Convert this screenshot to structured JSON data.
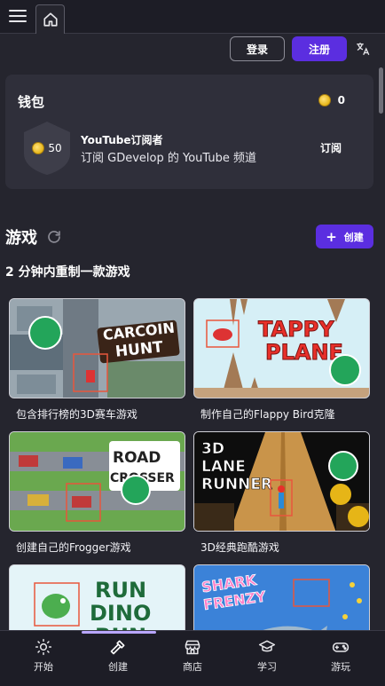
{
  "topbar": {
    "menu_icon": "hamburger-menu-icon",
    "home_icon": "home-icon"
  },
  "auth": {
    "login": "登录",
    "signup": "注册",
    "language_icon": "translate-icon"
  },
  "wallet": {
    "title": "钱包",
    "coins": "0",
    "badge_coins": "50",
    "youtube_title": "YouTube订阅者",
    "youtube_desc": "订阅 GDevelop 的 YouTube 频道",
    "subscribe": "订阅"
  },
  "games": {
    "title": "游戏",
    "create": "创建",
    "subtitle": "2 分钟内重制一款游戏",
    "cards": [
      {
        "label": "包含排行榜的3D赛车游戏",
        "art": "CARCOIN HUNT"
      },
      {
        "label": "制作自己的Flappy Bird克隆",
        "art": "TAPPY PLANE"
      },
      {
        "label": "创建自己的Frogger游戏",
        "art": "ROAD CROSSER"
      },
      {
        "label": "3D经典跑酷游戏",
        "art": "3D LANE RUNNER"
      },
      {
        "label": "",
        "art": "RUN DINO RUN"
      },
      {
        "label": "",
        "art": "SHARK FRENZY"
      }
    ]
  },
  "nav": {
    "items": [
      {
        "label": "开始",
        "icon": "sun-icon"
      },
      {
        "label": "创建",
        "icon": "hammer-icon"
      },
      {
        "label": "商店",
        "icon": "store-icon"
      },
      {
        "label": "学习",
        "icon": "graduation-cap-icon"
      },
      {
        "label": "游玩",
        "icon": "gamepad-icon"
      }
    ]
  },
  "colors": {
    "accent": "#5b2ee0",
    "background": "#25252e",
    "panel": "#2f2f3a"
  }
}
